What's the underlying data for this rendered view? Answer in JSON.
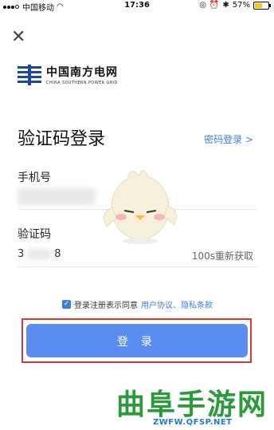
{
  "status_bar": {
    "carrier": "中国移动",
    "time": "17:36",
    "battery": "57%",
    "battery_level": 0.57
  },
  "brand": {
    "name_cn": "中国南方电网",
    "name_en": "CHINA SOUTHERN POWER GRID"
  },
  "page_title": "验证码登录",
  "password_login_link": "密码登录 >",
  "phone": {
    "label": "手机号",
    "value": ""
  },
  "code": {
    "label": "验证码",
    "value_start": "3",
    "value_end": "8",
    "resend": "100s重新获取"
  },
  "agreement": {
    "text": "登录注册表示同意",
    "links": "用户协议、隐私条款"
  },
  "login_button": "登 录",
  "watermark": {
    "title": "曲阜手游网",
    "url": "ZWFW.QFSP.NET"
  },
  "colors": {
    "accent": "#3d7de0",
    "button": "#5b8df0",
    "highlight_border": "#d23a3a",
    "watermark": "#2a9a3a"
  }
}
